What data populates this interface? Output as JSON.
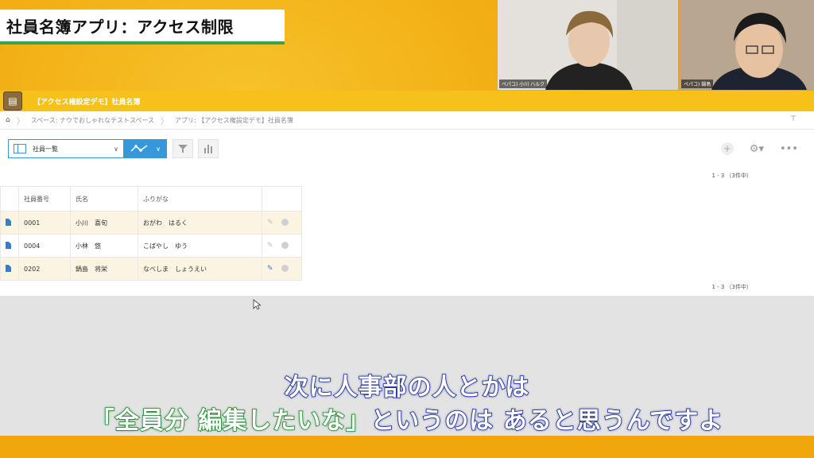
{
  "overlay": {
    "title": "社員名簿アプリ：アクセス制限",
    "cam1_label": "ペパコ) 小川 ハルク",
    "cam2_label": "ペパコ) 鍋島",
    "subtitle_line1": "次に人事部の人とかは",
    "subtitle_line2_green": "「全員分 編集したいな」",
    "subtitle_line2_blue": "というのは あると思うんですよ"
  },
  "app": {
    "header_title": "【アクセス権設定デモ】社員名簿",
    "breadcrumb": {
      "home": "⌂",
      "space": "スペース: ナウでおしゃれなテストスペース",
      "app": "アプリ: 【アクセス権設定デモ】社員名簿"
    },
    "view_select": "社員一覧",
    "count_top": "1 - 3 （3件中）",
    "count_bottom": "1 - 3 （3件中）",
    "columns": [
      "社員番号",
      "氏名",
      "ふりがな"
    ],
    "rows": [
      {
        "id": "0001",
        "name": "小川　喜旬",
        "kana": "おがわ　はるく",
        "editable": false
      },
      {
        "id": "0004",
        "name": "小林　悠",
        "kana": "こばやし　ゆう",
        "editable": false
      },
      {
        "id": "0202",
        "name": "鍋島　将栄",
        "kana": "なべしま　しょうえい",
        "editable": true
      }
    ]
  },
  "icons": {
    "home": "home-icon",
    "graph": "graph-icon",
    "filter": "filter-icon",
    "chart": "bar-chart-icon",
    "add": "plus-icon",
    "settings": "gear-icon",
    "more": "more-icon",
    "pin": "pin-icon",
    "record": "document-icon",
    "edit": "pencil-icon",
    "delete": "delete-icon"
  },
  "colors": {
    "accent": "#3498db",
    "header": "#f7c11b",
    "subtitle_blue": "#1a2a9c",
    "subtitle_green": "#1e8a2c"
  }
}
